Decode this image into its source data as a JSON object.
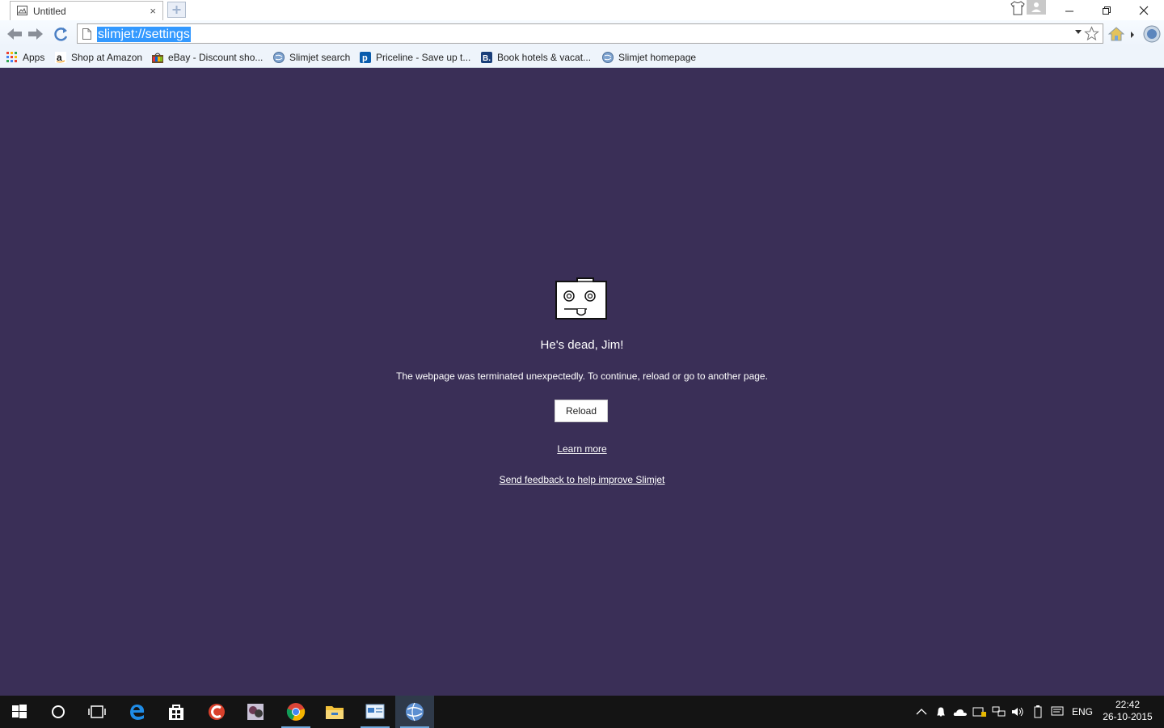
{
  "tab": {
    "title": "Untitled",
    "close_symbol": "×"
  },
  "omnibox": {
    "url": "slimjet://settings"
  },
  "bookmarks": [
    {
      "label": "Apps",
      "icon": "apps-grid-icon"
    },
    {
      "label": "Shop at Amazon",
      "icon": "amazon-icon"
    },
    {
      "label": "eBay - Discount sho...",
      "icon": "ebay-icon"
    },
    {
      "label": "Slimjet search",
      "icon": "slimjet-globe-icon"
    },
    {
      "label": "Priceline - Save up t...",
      "icon": "priceline-icon"
    },
    {
      "label": "Book hotels & vacat...",
      "icon": "booking-icon"
    },
    {
      "label": "Slimjet homepage",
      "icon": "slimjet-globe-icon"
    }
  ],
  "error_page": {
    "headline": "He's dead, Jim!",
    "message": "The webpage was terminated unexpectedly. To continue, reload or go to another page.",
    "reload_label": "Reload",
    "learn_more": "Learn more",
    "feedback": "Send feedback to help improve Slimjet"
  },
  "taskbar": {
    "language": "ENG",
    "time": "22:42",
    "date": "26-10-2015"
  },
  "colors": {
    "page_background": "#3a2f57",
    "taskbar": "#141414",
    "selection": "#3399ff"
  }
}
